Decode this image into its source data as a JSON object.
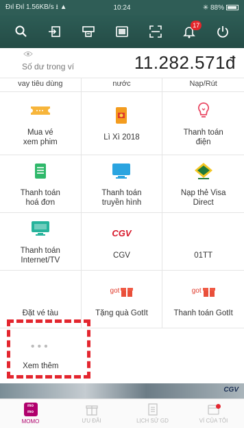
{
  "status_bar": {
    "left": "Đıl Đıl 1.56KB/s ⭳ ▲",
    "time": "10:24",
    "right": "✳ 88%"
  },
  "toolbar": {
    "notification_count": "17",
    "icons": [
      "search-icon",
      "transfer-in-icon",
      "withdraw-icon",
      "wallet-card-icon",
      "scan-qr-icon",
      "notification-bell-icon",
      "power-icon"
    ],
    "color": "#2d5c55"
  },
  "balance": {
    "label": "Số dư trong ví",
    "amount": "11.282.571đ"
  },
  "grid": {
    "top_row": [
      "vay tiêu dùng",
      "nước",
      "Nạp/Rút"
    ],
    "services": [
      {
        "label1": "Mua vé",
        "label2": "xem phim",
        "icon": "movie-ticket-icon"
      },
      {
        "label1": "Lì Xì 2018",
        "label2": "",
        "icon": "lucky-money-icon"
      },
      {
        "label1": "Thanh toán",
        "label2": "điện",
        "icon": "lightbulb-icon"
      },
      {
        "label1": "Thanh toán",
        "label2": "hoá đơn",
        "icon": "bill-icon"
      },
      {
        "label1": "Thanh toán",
        "label2": "truyền hình",
        "icon": "tv-icon"
      },
      {
        "label1": "Nạp thẻ Visa",
        "label2": "Direct",
        "icon": "visa-direct-icon"
      },
      {
        "label1": "Thanh toán",
        "label2": "Internet/TV",
        "icon": "internet-monitor-icon"
      },
      {
        "label1": "CGV",
        "label2": "",
        "icon": "cgv-logo-icon",
        "logo_text": "CGV"
      },
      {
        "label1": "01TT",
        "label2": "",
        "icon": ""
      },
      {
        "label1": "Đặt vé tàu",
        "label2": "",
        "icon": ""
      },
      {
        "label1": "Tặng quà GotIt",
        "label2": "",
        "icon": "gotit-gift-icon",
        "logo_text": "got"
      },
      {
        "label1": "Thanh toán GotIt",
        "label2": "",
        "icon": "gotit-gift-icon",
        "logo_text": "got"
      }
    ],
    "more": {
      "dots": "•••",
      "label": "Xem thêm"
    }
  },
  "banner": {
    "brand": "CGV"
  },
  "bottom_nav": {
    "items": [
      {
        "label": "MOMO",
        "active": true,
        "icon": "momo-logo-icon",
        "logo_text_1": "mo",
        "logo_text_2": "mo"
      },
      {
        "label": "ƯU ĐÃI",
        "active": false,
        "icon": "gift-icon"
      },
      {
        "label": "LỊCH SỬ GD",
        "active": false,
        "icon": "history-icon"
      },
      {
        "label": "VÍ CỦA TÔI",
        "active": false,
        "icon": "my-wallet-icon"
      }
    ],
    "active_color": "#b0006d"
  },
  "colors": {
    "accent": "#b0006d",
    "highlight": "#e3262f",
    "header": "#2d5c55"
  }
}
